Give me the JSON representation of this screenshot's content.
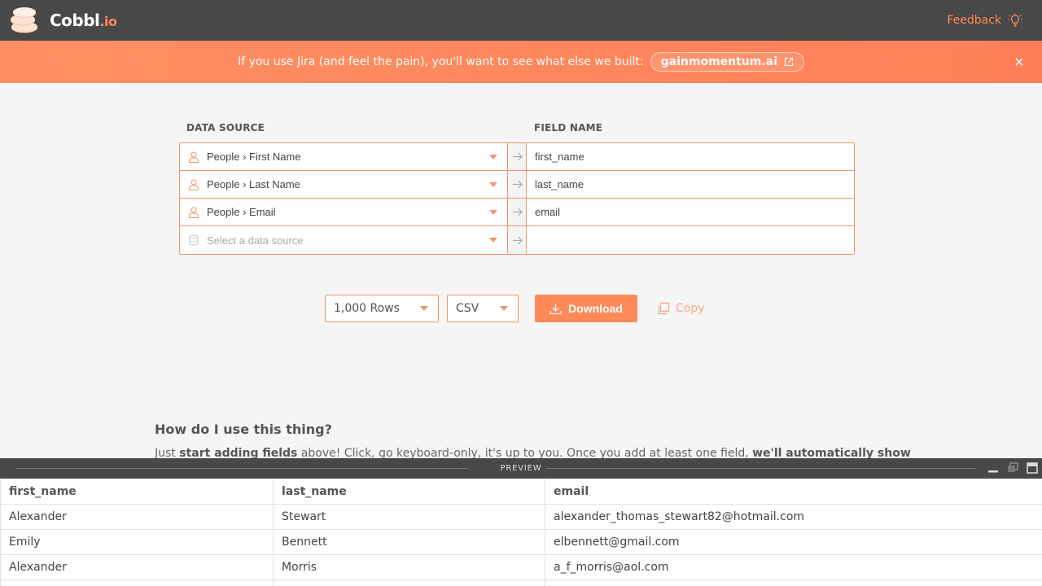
{
  "header": {
    "brand_name": "Cobbl",
    "brand_tld": ".io",
    "feedback_label": "Feedback"
  },
  "banner": {
    "message": "If you use Jira (and feel the pain), you'll want to see what else we built:",
    "link_label": "gainmomentum.ai",
    "close_glyph": "×"
  },
  "builder": {
    "data_source_header": "DATA SOURCE",
    "field_name_header": "FIELD NAME",
    "rows": [
      {
        "source": "People › First Name",
        "field": "first_name",
        "icon": "person-icon"
      },
      {
        "source": "People › Last Name",
        "field": "last_name",
        "icon": "person-icon"
      },
      {
        "source": "People › Email",
        "field": "email",
        "icon": "person-icon"
      },
      {
        "source": "",
        "placeholder": "Select a data source",
        "field": "",
        "icon": "database-icon"
      }
    ]
  },
  "controls": {
    "rows_value": "1,000 Rows",
    "format_value": "CSV",
    "download_label": "Download",
    "copy_label": "Copy"
  },
  "help": {
    "title": "How do I use this thing?",
    "text_1": "Just ",
    "bold_1": "start adding fields",
    "text_2": " above! Click, go keyboard-only, it's up to you. Once you add at least one field, ",
    "bold_2": "we'll automatically show"
  },
  "preview": {
    "label": "PREVIEW",
    "columns": [
      "first_name",
      "last_name",
      "email"
    ],
    "rows": [
      [
        "Alexander",
        "Stewart",
        "alexander_thomas_stewart82@hotmail.com"
      ],
      [
        "Emily",
        "Bennett",
        "elbennett@gmail.com"
      ],
      [
        "Alexander",
        "Morris",
        "a_f_morris@aol.com"
      ],
      [
        "",
        "",
        ""
      ]
    ]
  },
  "colors": {
    "accent": "#ff8a57",
    "header_bg": "#484848",
    "page_bg": "#f5f5f5"
  }
}
